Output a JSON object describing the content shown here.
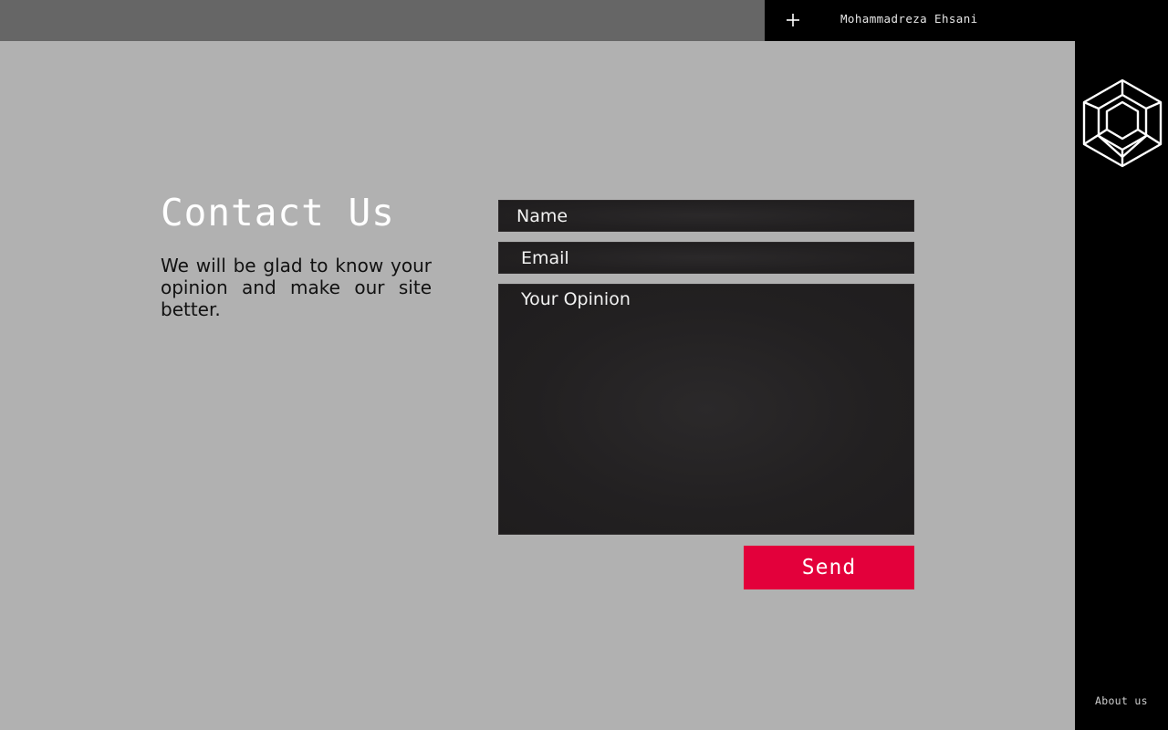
{
  "header": {
    "user_name": "Mohammadreza Ehsani",
    "add_icon": "plus-icon"
  },
  "sidebar": {
    "logo_icon": "hexagon-logo-icon",
    "about_label": "About us"
  },
  "contact": {
    "title": "Contact Us",
    "description": "We will be glad to know your opinion and make our site better."
  },
  "form": {
    "name_placeholder": "Name",
    "email_placeholder": "Email",
    "opinion_placeholder": "Your Opinion",
    "send_label": "Send"
  },
  "colors": {
    "background": "#b1b1b1",
    "topbar_grey": "#666666",
    "sidebar": "#000000",
    "field": "#222021",
    "accent": "#e3003b"
  }
}
